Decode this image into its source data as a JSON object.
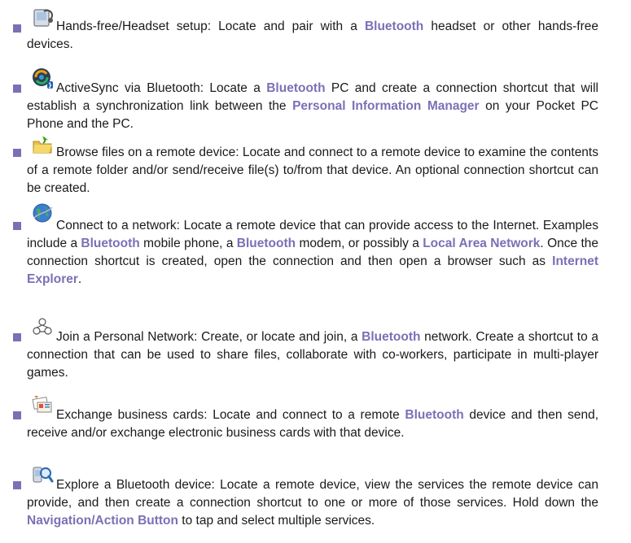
{
  "accent_color": "#7d6fb5",
  "items": [
    {
      "icon": "handsfree-headset-icon",
      "title": "Hands-free/Headset setup",
      "segments": [
        {
          "t": "Hands-free/Headset setup: Locate and pair with a "
        },
        {
          "t": "Bluetooth",
          "hl": true
        },
        {
          "t": " headset or other hands-free devices."
        }
      ]
    },
    {
      "icon": "activesync-icon",
      "title": "ActiveSync via Bluetooth",
      "segments": [
        {
          "t": "ActiveSync via Bluetooth: Locate a "
        },
        {
          "t": "Bluetooth",
          "hl": true
        },
        {
          "t": " PC and create a connection shortcut that will establish a synchronization link between the "
        },
        {
          "t": "Personal Information Manager",
          "hl": true
        },
        {
          "t": " on your Pocket PC Phone and the PC."
        }
      ]
    },
    {
      "icon": "browse-files-icon",
      "title": "Browse files on a remote device",
      "segments": [
        {
          "t": "Browse files on a remote device: Locate and connect to a remote device to examine the contents of a remote folder and/or send/receive file(s) to/from that device. An optional connection shortcut can be created."
        }
      ]
    },
    {
      "icon": "connect-network-icon",
      "title": "Connect to a network",
      "segments": [
        {
          "t": "Connect to a network: Locate a remote device that can provide access to the Internet. Examples include a "
        },
        {
          "t": "Bluetooth",
          "hl": true
        },
        {
          "t": " mobile phone, a "
        },
        {
          "t": "Bluetooth",
          "hl": true
        },
        {
          "t": " modem, or possibly a "
        },
        {
          "t": "Local Area Network",
          "hl": true
        },
        {
          "t": ". Once the connection shortcut is created, open the connection and then open a browser such as "
        },
        {
          "t": "Internet Explorer",
          "hl": true
        },
        {
          "t": "."
        }
      ]
    },
    {
      "icon": "personal-network-icon",
      "title": "Join a Personal Network",
      "segments": [
        {
          "t": "Join a Personal Network: Create, or locate and join, a "
        },
        {
          "t": "Bluetooth",
          "hl": true
        },
        {
          "t": " network. Create a shortcut to a connection that can be used to share files, collaborate with co-workers, participate in multi-player games."
        }
      ]
    },
    {
      "icon": "business-cards-icon",
      "title": "Exchange business cards",
      "segments": [
        {
          "t": "Exchange business cards: Locate and connect to a remote "
        },
        {
          "t": "Bluetooth",
          "hl": true
        },
        {
          "t": " device and then send, receive and/or exchange electronic business cards with that device."
        }
      ]
    },
    {
      "icon": "explore-device-icon",
      "title": "Explore a Bluetooth device",
      "segments": [
        {
          "t": "Explore a Bluetooth device: Locate a remote device, view the services the remote device can provide, and then create a connection shortcut to one or more of those services. Hold down the "
        },
        {
          "t": "Navigation/Action Button",
          "hl": true
        },
        {
          "t": " to tap and select multiple services."
        }
      ]
    }
  ]
}
